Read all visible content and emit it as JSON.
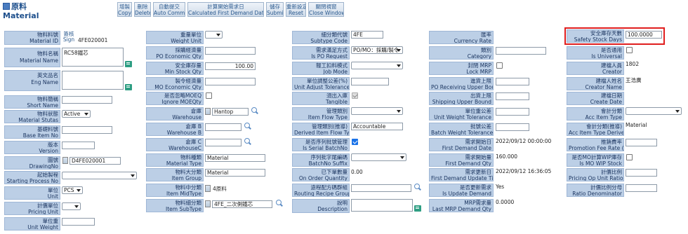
{
  "header": {
    "title_zh": "原料",
    "title_en": "Material"
  },
  "toolbar": [
    {
      "zh": "增製",
      "en": "Copy"
    },
    {
      "zh": "刪除",
      "en": "Delete"
    },
    {
      "zh": "自動提交",
      "en": "Auto Commit"
    },
    {
      "zh": "計算開始需求日",
      "en": "Calculated First Demand Date"
    },
    {
      "zh": "儲存",
      "en": "Submit"
    },
    {
      "zh": "重新設定",
      "en": "Reset"
    },
    {
      "zh": "關閉視窗",
      "en": "Close Window"
    }
  ],
  "col1": {
    "material_id": {
      "zh": "物料料號",
      "en": "Material ID",
      "sign_zh": "簽核",
      "sign_en": "Sign",
      "value": "4FE020001"
    },
    "material_name": {
      "zh": "物料名稱",
      "en": "Material Name",
      "value": "RC58鐵芯"
    },
    "eng_name": {
      "zh": "英文品名",
      "en": "Eng Name",
      "value": ""
    },
    "short_name": {
      "zh": "物料簡稱",
      "en": "Short Name",
      "value": ""
    },
    "material_status": {
      "zh": "物料狀態",
      "en": "Material Stutas",
      "value": "Active"
    },
    "base_item_no": {
      "zh": "基礎料號",
      "en": "Base Item No",
      "value": ""
    },
    "version": {
      "zh": "版本",
      "en": "Version",
      "value": ""
    },
    "drawing_no": {
      "zh": "圖號",
      "en": "DrawingNo",
      "value": "D4FE020001"
    },
    "starting_process_no": {
      "zh": "起始製程",
      "en": "Starting Process No",
      "value": ""
    },
    "unit": {
      "zh": "單位",
      "en": "Unit",
      "value": "PCS"
    },
    "pricing_unit": {
      "zh": "計價單位",
      "en": "Pricing Unit",
      "value": ""
    },
    "unit_weight": {
      "zh": "單位重",
      "en": "Unit Weight",
      "value": ""
    }
  },
  "col2": {
    "weight_unit": {
      "zh": "重量單位",
      "en": "Weight Unit",
      "value": ""
    },
    "po_economic_qty": {
      "zh": "採購經濟量",
      "en": "PO Economic Qty",
      "value": ""
    },
    "min_stock_qty": {
      "zh": "安全庫存量",
      "en": "Min Stock Qty",
      "value": "100.00"
    },
    "mo_economic_qty": {
      "zh": "製令經濟量",
      "en": "MO Economic Qty",
      "value": ""
    },
    "ignore_moeqty": {
      "zh": "是否忽略MOEQ",
      "en": "Ignore MOEQty",
      "checked": false
    },
    "warehouse": {
      "zh": "倉庫",
      "en": "Warehouse",
      "value": "Hantop"
    },
    "warehouse_b": {
      "zh": "倉庫 B",
      "en": "Warehouse B",
      "value": ""
    },
    "warehouse_c": {
      "zh": "倉庫 C",
      "en": "WarehouseC",
      "value": ""
    },
    "material_type": {
      "zh": "物料種類",
      "en": "Material Type",
      "value": "Material"
    },
    "item_group": {
      "zh": "物料大分類",
      "en": "Item Group",
      "value": "Material"
    },
    "item_midtype": {
      "zh": "物料中分類",
      "en": "Item MidType",
      "value": "4原料"
    },
    "item_subtype": {
      "zh": "物料細分類",
      "en": "Item SubType",
      "value": "4FE_二次側鐵芯"
    }
  },
  "col3": {
    "subtype_code": {
      "zh": "細分類代號",
      "en": "Subtype Code",
      "value": "4FE"
    },
    "is_po_request": {
      "zh": "需求滿足方式",
      "en": "Is PO Request",
      "value": "PO/MO：採購/製令"
    },
    "job_mode": {
      "zh": "報工扣料模式",
      "en": "Job Mode",
      "value": ""
    },
    "unit_adjust_tolerance": {
      "zh": "單位調整公差(%)",
      "en": "Unit Adjust Tolerance",
      "value": ""
    },
    "tangible": {
      "zh": "須出入庫",
      "en": "Tangible",
      "checked": true
    },
    "item_flow_type": {
      "zh": "管理類別",
      "en": "Item Flow Type",
      "value": ""
    },
    "derived_item_flow_type": {
      "zh": "管理類別(推導)",
      "en": "Derived Item Flow Type",
      "value": "Accountable"
    },
    "is_serial_batchno": {
      "zh": "是否序列批號管理",
      "en": "Is Serial BatchNo",
      "checked": true
    },
    "batchno_suffix": {
      "zh": "序列批字尾編碼",
      "en": "BatchNo Suffix",
      "value": ""
    },
    "on_order_quantity": {
      "zh": "已下單數量",
      "en": "On Order Quantity",
      "value": "0.00"
    },
    "routing_recipe_group": {
      "zh": "途程配方碼群組",
      "en": "Routing Recipe Group",
      "value": ""
    },
    "description": {
      "zh": "說明",
      "en": "Description",
      "value": ""
    }
  },
  "col4": {
    "currency_rate": {
      "zh": "匯率",
      "en": "Currency Rate",
      "value": ""
    },
    "category": {
      "zh": "類別",
      "en": "Category",
      "value": ""
    },
    "lock_mrp": {
      "zh": "封閉 MRP",
      "en": "Lock MRP",
      "checked": false
    },
    "po_receiving_upper_bound": {
      "zh": "進貨上限",
      "en": "PO Receiving Upper Bound",
      "value": ""
    },
    "shipping_upper_bound": {
      "zh": "出貨上限",
      "en": "Shipping Upper Bound",
      "value": ""
    },
    "unit_weight_tolerance": {
      "zh": "單位重公差",
      "en": "Unit Weight Tolerance",
      "value": ""
    },
    "batch_weight_tolerance": {
      "zh": "批號公差",
      "en": "Batch Weight Tolerance",
      "value": ""
    },
    "first_demand_date": {
      "zh": "需求開始日",
      "en": "First Demand Date",
      "value": "2022/09/12 00:00:00"
    },
    "first_demand_qty": {
      "zh": "需求開始量",
      "en": "First Demand Qty",
      "value": "160.000"
    },
    "first_demand_update_time": {
      "zh": "需求更新日",
      "en": "First Demand Update Time",
      "value": "2022/09/12 16:36:05"
    },
    "is_update_demand": {
      "zh": "是否更新需求",
      "en": "Is Update Demand",
      "value": "Yes"
    },
    "last_mrp_demand_qty": {
      "zh": "MRP需求量",
      "en": "Last MRP Demand Qty",
      "value": "0.0000"
    }
  },
  "col5": {
    "safety_stock_days": {
      "zh": "安全庫存天數",
      "en": "Safety Stock Days",
      "value": "100.0000"
    },
    "is_universal": {
      "zh": "是否通用",
      "en": "Is Universal",
      "checked": false
    },
    "creator": {
      "zh": "建檔人員",
      "en": "Creator",
      "value": "1802"
    },
    "creator_name": {
      "zh": "建檔人姓名",
      "en": "Creator Name",
      "value": "王浩廣"
    },
    "create_date": {
      "zh": "建檔日期",
      "en": "Create Date",
      "value": ""
    },
    "acc_item_type": {
      "zh": "會計分類",
      "en": "Acc Item Type",
      "value": ""
    },
    "acc_item_type_derive": {
      "zh": "會計分類(推導)",
      "en": "Acc Item Type Derive",
      "value": "Material"
    },
    "promotion_fee_rate": {
      "zh": "推銷費率",
      "en": "Promotion Fee Rate (%)",
      "value": ""
    },
    "is_mo_wip_stock": {
      "zh": "是否MO計算WIP庫存",
      "en": "Is MO WIP Stock",
      "checked": false
    },
    "pricing_on_unit_ratio": {
      "zh": "計價比例",
      "en": "Pricing Op Unit Ratio",
      "value": ""
    },
    "ratio_denominator": {
      "zh": "計價比例分母",
      "en": "Ratio Denominator",
      "value": ""
    }
  }
}
